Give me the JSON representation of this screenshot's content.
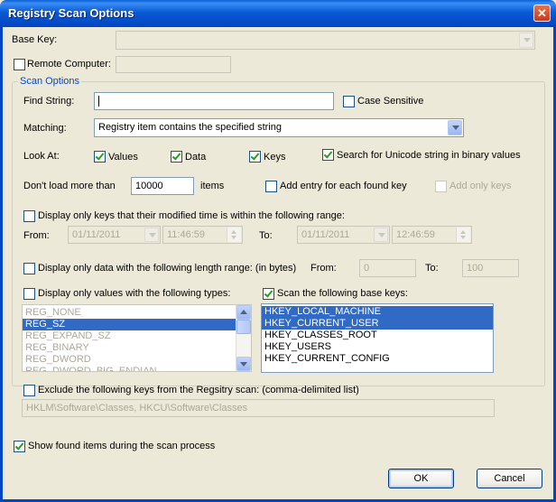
{
  "window": {
    "title": "Registry Scan Options",
    "close_glyph": "✕"
  },
  "base_key": {
    "label": "Base Key:",
    "value": ""
  },
  "remote_computer": {
    "label": "Remote Computer:",
    "checked": false,
    "value": ""
  },
  "scan_options": {
    "legend": "Scan Options",
    "find_string": {
      "label": "Find String:",
      "value": ""
    },
    "case_sensitive": {
      "label": "Case Sensitive",
      "checked": false
    },
    "matching": {
      "label": "Matching:",
      "value": "Registry item contains the specified string"
    },
    "look_at": {
      "label": "Look At:",
      "values": {
        "label": "Values",
        "checked": true
      },
      "data": {
        "label": "Data",
        "checked": true
      },
      "keys": {
        "label": "Keys",
        "checked": true
      },
      "unicode": {
        "label": "Search for Unicode string in binary values",
        "checked": true
      }
    },
    "dont_load": {
      "label": "Don't load more than",
      "value": "10000",
      "units": "items"
    },
    "add_entry": {
      "label": "Add entry for each found key",
      "checked": false
    },
    "add_only_keys": {
      "label": "Add only keys",
      "checked": false
    }
  },
  "modified_time": {
    "label": "Display only keys that their modified time is within the following range:",
    "checked": false,
    "from_label": "From:",
    "from_date": "01/11/2011",
    "from_time": "11:46:59",
    "to_label": "To:",
    "to_date": "01/11/2011",
    "to_time": "12:46:59"
  },
  "length_range": {
    "label": "Display only data with the following length range: (in bytes)",
    "checked": false,
    "from_label": "From:",
    "from_value": "0",
    "to_label": "To:",
    "to_value": "100"
  },
  "value_types": {
    "label": "Display only values with the following types:",
    "checked": false,
    "items": [
      "REG_NONE",
      "REG_SZ",
      "REG_EXPAND_SZ",
      "REG_BINARY",
      "REG_DWORD",
      "REG_DWORD_BIG_ENDIAN"
    ],
    "selected": [
      "REG_SZ"
    ]
  },
  "base_keys": {
    "label": "Scan the following base keys:",
    "checked": true,
    "items": [
      "HKEY_LOCAL_MACHINE",
      "HKEY_CURRENT_USER",
      "HKEY_CLASSES_ROOT",
      "HKEY_USERS",
      "HKEY_CURRENT_CONFIG"
    ],
    "selected": [
      "HKEY_LOCAL_MACHINE",
      "HKEY_CURRENT_USER"
    ]
  },
  "exclude": {
    "label": "Exclude the following keys from the Regsitry scan: (comma-delimited list)",
    "checked": false,
    "value": "HKLM\\Software\\Classes, HKCU\\Software\\Classes"
  },
  "show_found": {
    "label": "Show found items during the scan process",
    "checked": true
  },
  "buttons": {
    "ok": "OK",
    "cancel": "Cancel"
  }
}
